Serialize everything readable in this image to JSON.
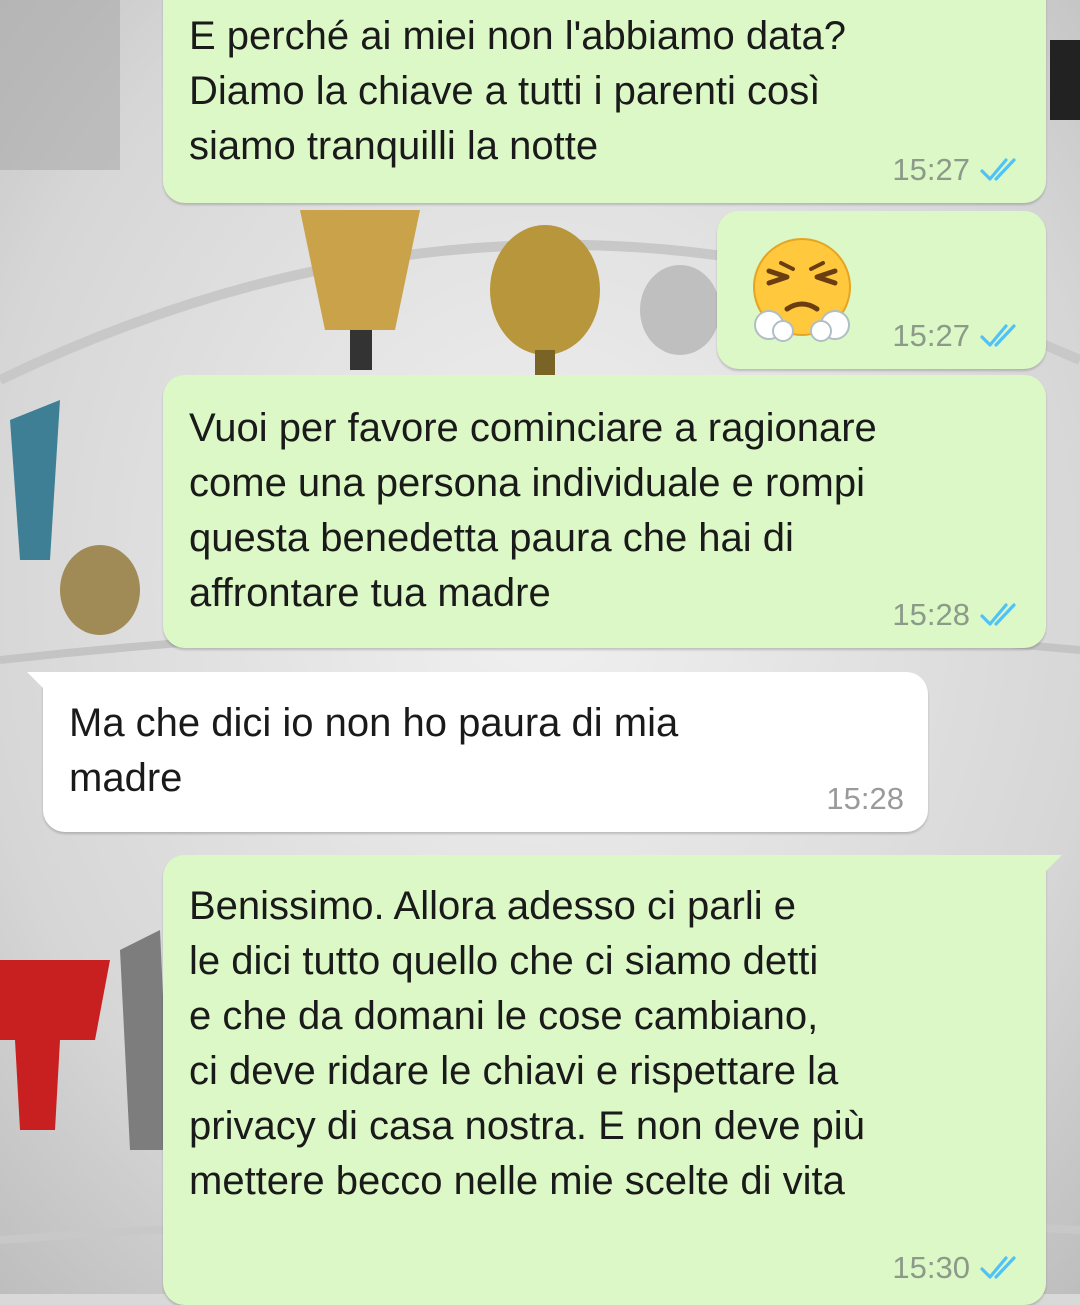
{
  "colors": {
    "outgoing_bubble": "#dcf8c6",
    "incoming_bubble": "#ffffff",
    "read_ticks": "#4fc3f7",
    "timestamp": "#8c9a89"
  },
  "messages": [
    {
      "direction": "outgoing",
      "text": "E perché ai miei non l'abbiamo data?\nDiamo la chiave a tutti i parenti così\nsiamo tranquilli la notte",
      "time": "15:27",
      "status_icon": "double-check-read-icon"
    },
    {
      "direction": "outgoing",
      "emoji": "face-with-steam-from-nose",
      "time": "15:27",
      "status_icon": "double-check-read-icon"
    },
    {
      "direction": "outgoing",
      "text": "Vuoi per favore cominciare a ragionare\ncome una persona individuale e rompi\nquesta benedetta paura che hai di\naffrontare tua madre",
      "time": "15:28",
      "status_icon": "double-check-read-icon"
    },
    {
      "direction": "incoming",
      "text": "Ma che dici io non ho paura di mia\nmadre",
      "time": "15:28"
    },
    {
      "direction": "outgoing",
      "text": "Benissimo. Allora adesso ci parli e\nle dici tutto quello che ci siamo detti\ne che da domani le cose cambiano,\nci deve ridare le chiavi e rispettare la\nprivacy di casa nostra. E non deve più\nmettere becco nelle mie scelte di vita",
      "time": "15:30",
      "status_icon": "double-check-read-icon"
    }
  ]
}
